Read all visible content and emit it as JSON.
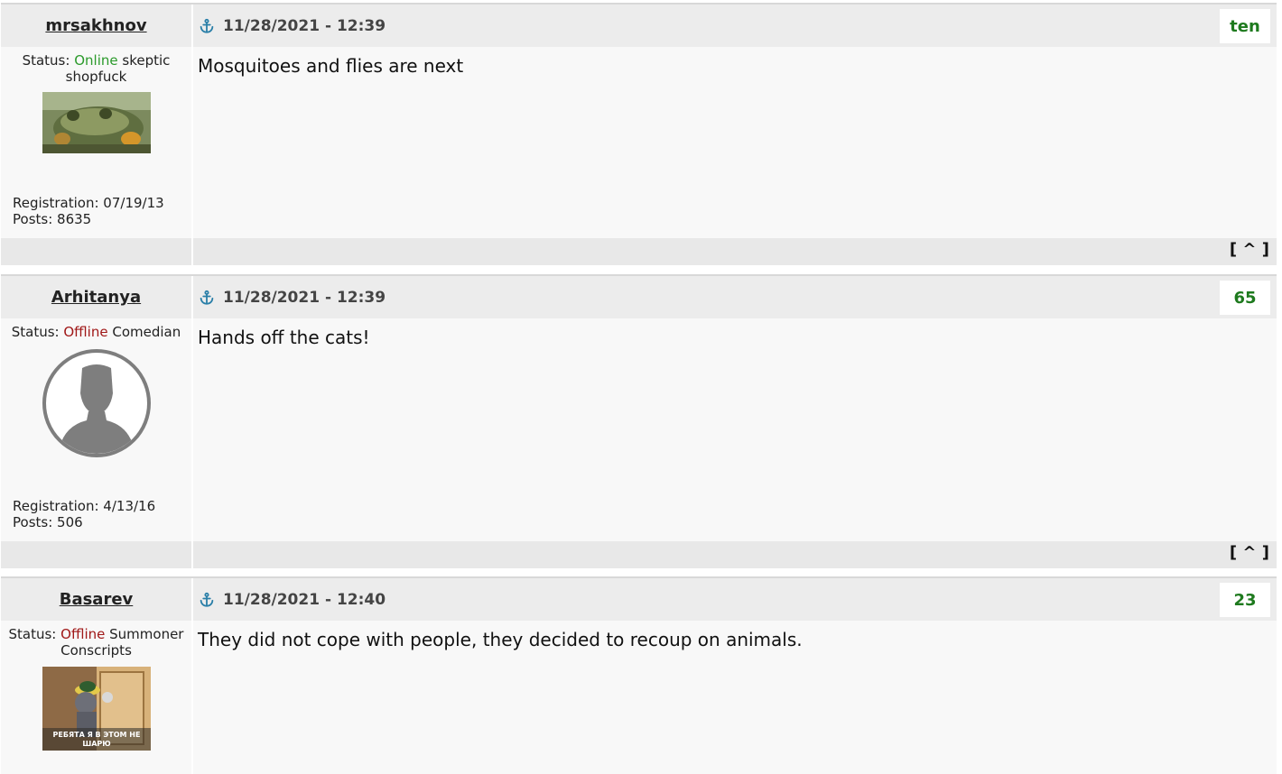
{
  "posts": [
    {
      "username": "mrsakhnov",
      "datetime": "11/28/2021 - 12:39",
      "rating": "ten",
      "status_label": "Status:",
      "status": "Online",
      "rank": "skeptic shopfuck",
      "registration_label": "Registration:",
      "registration": "07/19/13",
      "posts_label": "Posts:",
      "posts_count": "8635",
      "message": "Mosquitoes and flies are next",
      "up_label": "[ ^ ]"
    },
    {
      "username": "Arhitanya",
      "datetime": "11/28/2021 - 12:39",
      "rating": "65",
      "status_label": "Status:",
      "status": "Offline",
      "rank": "Comedian",
      "registration_label": "Registration:",
      "registration": "4/13/16",
      "posts_label": "Posts:",
      "posts_count": "506",
      "message": "Hands off the cats!",
      "up_label": "[ ^ ]"
    },
    {
      "username": "Basarev",
      "datetime": "11/28/2021 - 12:40",
      "rating": "23",
      "status_label": "Status:",
      "status": "Offline",
      "rank": "Summoner Conscripts",
      "message": "They did not cope with people, they decided to recoup on animals.",
      "avatar_caption_1": "РЕБЯТА Я В ЭТОМ НЕ",
      "avatar_caption_2": "ШАРЮ"
    }
  ],
  "colors": {
    "online": "#2b9a2b",
    "offline": "#a01818",
    "rating": "#1e7a1e",
    "anchor": "#2a7fa8"
  },
  "icons": {
    "anchor": "anchor-icon",
    "avatar_default": "default-avatar-icon"
  }
}
